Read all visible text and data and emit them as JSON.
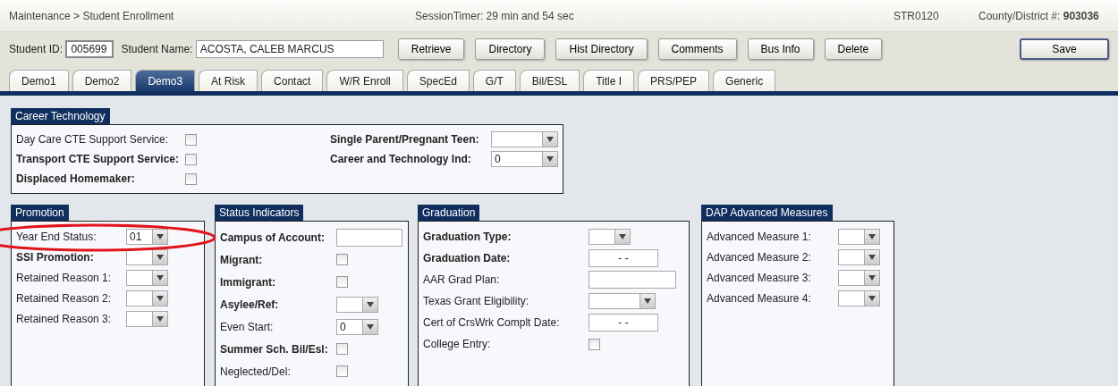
{
  "header": {
    "breadcrumb": "Maintenance > Student Enrollment",
    "session_timer": "SessionTimer: 29 min and 54 sec",
    "screen_code": "STR0120",
    "district_label": "County/District #:",
    "district_value": "903036"
  },
  "student": {
    "id_label": "Student ID:",
    "id_value": "005699",
    "name_label": "Student Name:",
    "name_value": "ACOSTA, CALEB MARCUS"
  },
  "buttons": [
    "Retrieve",
    "Directory",
    "Hist Directory",
    "Comments",
    "Bus Info",
    "Delete"
  ],
  "save_button": "Save",
  "tabs": [
    {
      "label": "Demo1",
      "selected": false
    },
    {
      "label": "Demo2",
      "selected": false
    },
    {
      "label": "Demo3",
      "selected": true
    },
    {
      "label": "At Risk",
      "selected": false
    },
    {
      "label": "Contact",
      "selected": false
    },
    {
      "label": "W/R Enroll",
      "selected": false
    },
    {
      "label": "SpecEd",
      "selected": false
    },
    {
      "label": "G/T",
      "selected": false
    },
    {
      "label": "Bil/ESL",
      "selected": false
    },
    {
      "label": "Title I",
      "selected": false
    },
    {
      "label": "PRS/PEP",
      "selected": false
    },
    {
      "label": "Generic",
      "selected": false
    }
  ],
  "career_technology": {
    "title": "Career Technology",
    "left": [
      {
        "label": "Day Care CTE Support Service:",
        "bold": false,
        "kind": "checkbox",
        "checked": false
      },
      {
        "label": "Transport CTE Support Service:",
        "bold": true,
        "kind": "checkbox",
        "checked": false
      },
      {
        "label": "Displaced Homemaker:",
        "bold": true,
        "kind": "checkbox",
        "checked": false
      }
    ],
    "right": [
      {
        "label": "Single Parent/Pregnant Teen:",
        "bold": true,
        "kind": "wide-select"
      },
      {
        "label": "Career and Technology Ind:",
        "bold": true,
        "kind": "wide-select",
        "value": "0"
      }
    ]
  },
  "panels": [
    {
      "title": "Promotion",
      "fields": [
        {
          "label": "Year End Status:",
          "bold": false,
          "kind": "select",
          "value": "01"
        },
        {
          "label": "SSI Promotion:",
          "bold": true,
          "kind": "select"
        },
        {
          "label": "Retained Reason 1:",
          "bold": false,
          "kind": "select"
        },
        {
          "label": "Retained Reason 2:",
          "bold": false,
          "kind": "select"
        },
        {
          "label": "Retained Reason 3:",
          "bold": false,
          "kind": "select"
        }
      ]
    },
    {
      "title": "Status Indicators",
      "fields": [
        {
          "label": "Campus of Account:",
          "bold": true,
          "kind": "text"
        },
        {
          "label": "Migrant:",
          "bold": true,
          "kind": "checkbox",
          "checked": false
        },
        {
          "label": "Immigrant:",
          "bold": true,
          "kind": "checkbox",
          "checked": false
        },
        {
          "label": "Asylee/Ref:",
          "bold": true,
          "kind": "select"
        },
        {
          "label": "Even Start:",
          "bold": false,
          "kind": "select",
          "value": "0"
        },
        {
          "label": "Summer Sch. Bil/Esl:",
          "bold": true,
          "kind": "checkbox",
          "checked": false
        },
        {
          "label": "Neglected/Del:",
          "bold": false,
          "kind": "checkbox",
          "checked": false
        }
      ]
    },
    {
      "title": "Graduation",
      "fields": [
        {
          "label": "Graduation Type:",
          "bold": true,
          "kind": "select"
        },
        {
          "label": "Graduation Date:",
          "bold": true,
          "kind": "date",
          "value": "- -"
        },
        {
          "label": "AAR Grad Plan:",
          "bold": false,
          "kind": "wide-text"
        },
        {
          "label": "Texas Grant Eligibility:",
          "bold": false,
          "kind": "wide-select"
        },
        {
          "label": "Cert of CrsWrk Complt Date:",
          "bold": false,
          "kind": "date",
          "value": "- -"
        },
        {
          "label": "College Entry:",
          "bold": false,
          "kind": "checkbox",
          "checked": false
        }
      ]
    },
    {
      "title": "DAP Advanced Measures",
      "fields": [
        {
          "label": "Advanced Measure 1:",
          "bold": false,
          "kind": "select"
        },
        {
          "label": "Advanced Measure 2:",
          "bold": false,
          "kind": "select"
        },
        {
          "label": "Advanced Measure 3:",
          "bold": false,
          "kind": "select"
        },
        {
          "label": "Advanced Measure 4:",
          "bold": false,
          "kind": "select"
        }
      ]
    }
  ]
}
